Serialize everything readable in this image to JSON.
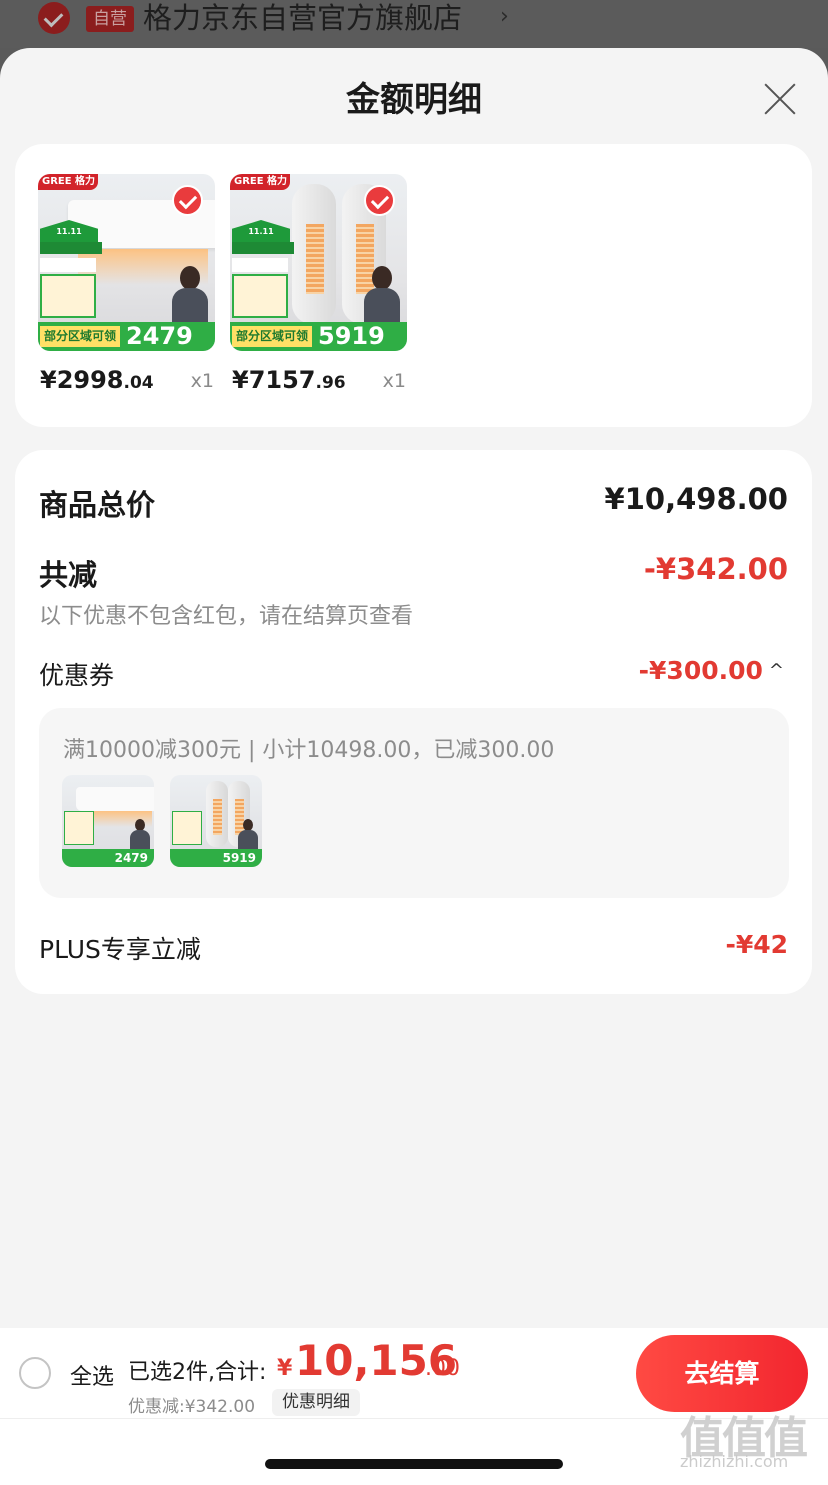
{
  "store": {
    "badge": "自营",
    "name": "格力京东自营官方旗舰店",
    "arrow": "›"
  },
  "sheet": {
    "title": "金额明细",
    "close_icon": "close-icon"
  },
  "products": [
    {
      "brand_logo": "GREE 格力",
      "promo_price": "2479",
      "pre_label": "部分区域可领",
      "price_main": "¥2998",
      "price_cents": ".04",
      "qty": "x1"
    },
    {
      "brand_logo": "GREE 格力",
      "promo_price": "5919",
      "pre_label": "部分区域可领",
      "price_main": "¥7157",
      "price_cents": ".96",
      "qty": "x1"
    }
  ],
  "details": {
    "total_label": "商品总价",
    "total_value": "¥10,498.00",
    "reduce_label": "共减",
    "reduce_value": "-¥342.00",
    "reduce_note": "以下优惠不包含红包，请在结算页查看",
    "coupon_label": "优惠券",
    "coupon_value": "-¥300.00",
    "coupon_caret": "^",
    "coupon_desc": "满10000减300元 | 小计10498.00，已减300.00",
    "mini_thumbs": [
      {
        "promo": "2479"
      },
      {
        "promo": "5919"
      }
    ],
    "plus_label": "PLUS专享立减",
    "plus_value": "-¥42"
  },
  "bottom_bar": {
    "select_all": "全选",
    "selected_count": "已选2件,合计:",
    "currency": "¥",
    "total_int": "10,156",
    "total_cents": ".00",
    "discount_line": "优惠减:¥342.00",
    "detail_chip": "优惠明细",
    "checkout": "去结算"
  },
  "watermark": {
    "main": "值值值",
    "sub": "zhizhizhi.com"
  },
  "colors": {
    "accent_red": "#e23a32",
    "checkout_red": "#f2262f",
    "background": "#f4f4f4"
  }
}
